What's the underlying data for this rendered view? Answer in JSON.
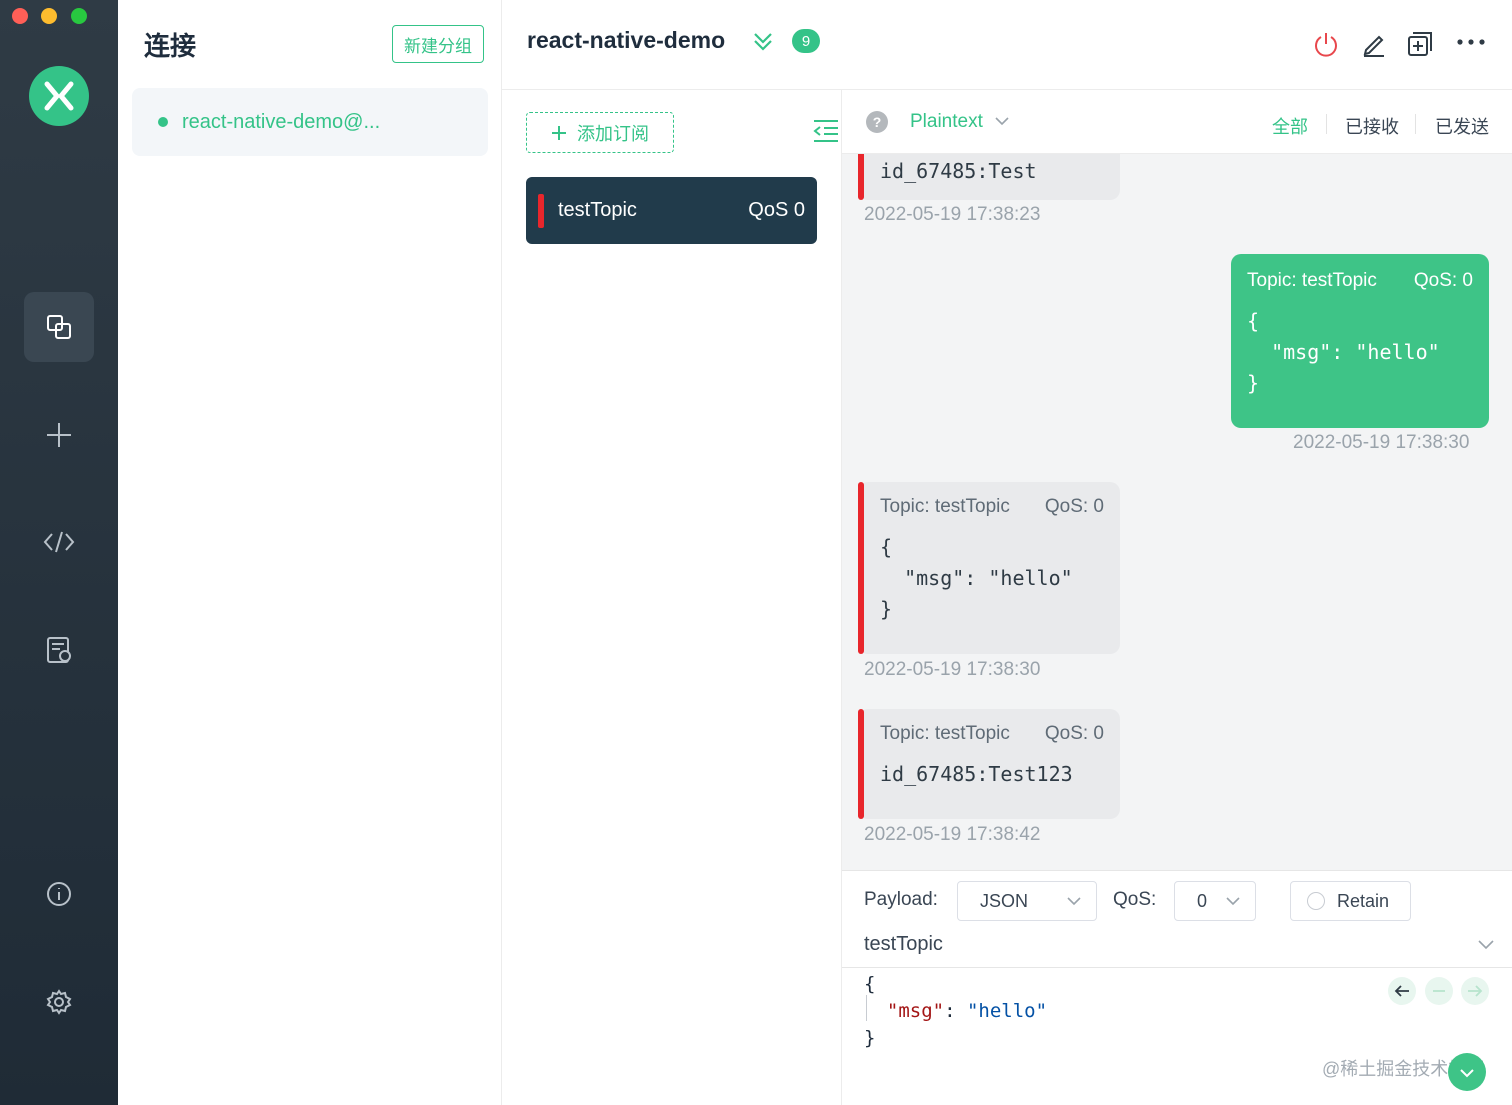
{
  "sidebar": {
    "colors": {
      "close": "#ff5f57",
      "minimize": "#febc2e",
      "maximize": "#28c840",
      "brand": "#34c388"
    },
    "items": [
      {
        "icon": "connections-icon",
        "active": true
      },
      {
        "icon": "plus-icon",
        "active": false
      },
      {
        "icon": "script-icon",
        "active": false
      },
      {
        "icon": "log-icon",
        "active": false
      },
      {
        "icon": "info-icon",
        "active": false
      },
      {
        "icon": "gear-icon",
        "active": false
      }
    ]
  },
  "connections": {
    "title": "连接",
    "new_group_label": "新建分组",
    "items": [
      {
        "name": "react-native-demo@...",
        "status": "connected"
      }
    ]
  },
  "header": {
    "connection_name": "react-native-demo",
    "unread_count": "9"
  },
  "subscriptions": {
    "add_label": "添加订阅",
    "items": [
      {
        "topic": "testTopic",
        "qos": "QoS 0",
        "color": "#e8262c"
      }
    ]
  },
  "messages": {
    "help": "?",
    "format": "Plaintext",
    "filters": {
      "all": "全部",
      "received": "已接收",
      "sent": "已发送"
    },
    "list": [
      {
        "direction": "received",
        "payload": "id_67485:Test",
        "time": "2022-05-19 17:38:23"
      },
      {
        "direction": "sent",
        "topic": "Topic: testTopic",
        "qos": "QoS: 0",
        "payload": "{\n  \"msg\": \"hello\"\n}",
        "time": "2022-05-19 17:38:30"
      },
      {
        "direction": "received",
        "topic": "Topic: testTopic",
        "qos": "QoS: 0",
        "payload": "{\n  \"msg\": \"hello\"\n}",
        "time": "2022-05-19 17:38:30"
      },
      {
        "direction": "received",
        "topic": "Topic: testTopic",
        "qos": "QoS: 0",
        "payload": "id_67485:Test123",
        "time": "2022-05-19 17:38:42"
      }
    ]
  },
  "publish": {
    "payload_label": "Payload:",
    "payload_format": "JSON",
    "qos_label": "QoS:",
    "qos_value": "0",
    "retain_label": "Retain",
    "topic": "testTopic",
    "editor": {
      "open": "{",
      "key": "\"msg\"",
      "colon": ": ",
      "value": "\"hello\"",
      "close": "}"
    },
    "watermark": "@稀土掘金技术社区"
  }
}
